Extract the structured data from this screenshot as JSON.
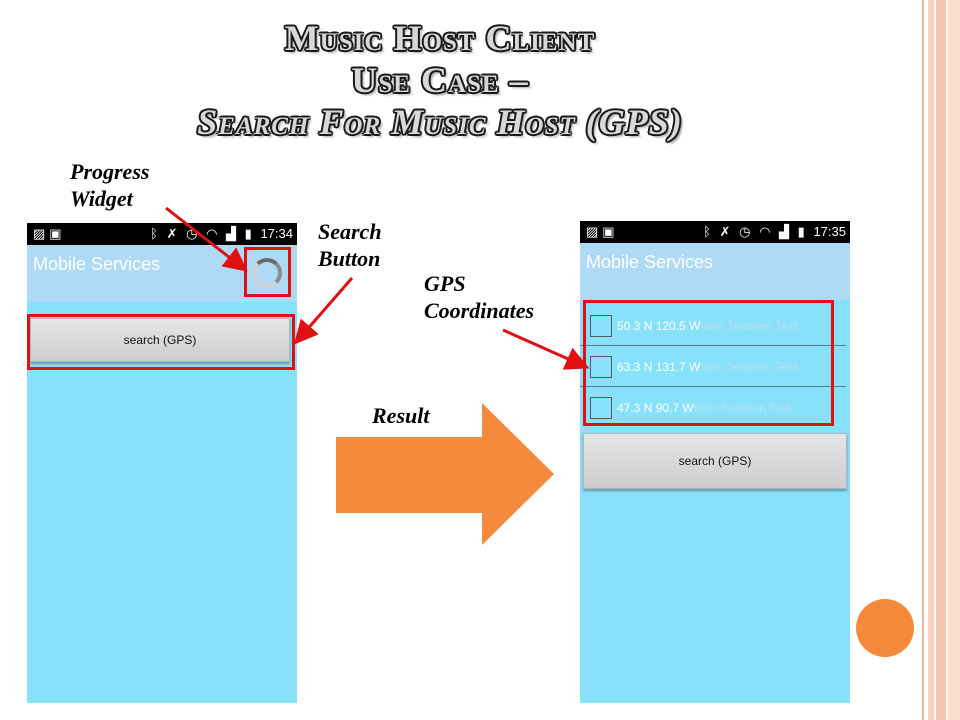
{
  "slide": {
    "title_lines": [
      "Music Host Client",
      "Use Case –",
      "Search For Music Host (GPS)"
    ],
    "annotations": {
      "progress_widget": [
        "Progress",
        "Widget"
      ],
      "search_button": [
        "Search",
        "Button"
      ],
      "gps_coordinates": [
        "GPS",
        "Coordinates"
      ],
      "result": "Result"
    },
    "colors": {
      "accent_orange": "#f68a3c",
      "highlight_red": "#e01010",
      "frame": "#f4c6b2"
    }
  },
  "phone_before": {
    "status_icons_left": [
      "image-icon",
      "briefcase-icon"
    ],
    "status_icons_right": [
      "bluetooth-icon",
      "mute-icon",
      "alarm-icon",
      "wifi-icon",
      "signal-icon",
      "battery-icon"
    ],
    "time": "17:34",
    "app_title": "Mobile Services",
    "search_button_label": "search (GPS)",
    "progress_state": "loading"
  },
  "phone_after": {
    "time": "17:35",
    "app_title": "Mobile Services",
    "results": [
      {
        "coords": "50.3 N 120.5 W",
        "ghost": "Item TextItem Text"
      },
      {
        "coords": "63.3 N 131.7 W",
        "ghost": "Item TextItem Text"
      },
      {
        "coords": "47.3 N 90.7 W",
        "ghost": "Item TextItem Text"
      }
    ],
    "search_button_label": "search (GPS)"
  }
}
